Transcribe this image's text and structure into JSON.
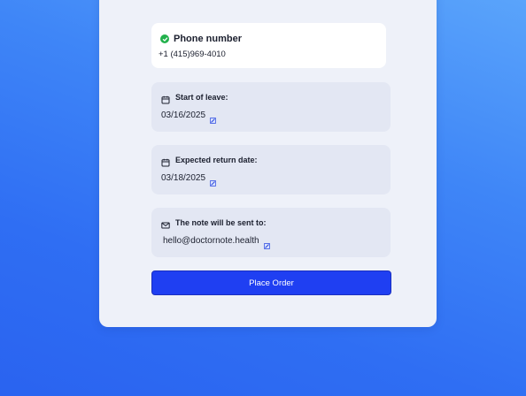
{
  "phone": {
    "title": "Phone number",
    "value": "+1 (415)969-4010",
    "icon": "check-circle-icon"
  },
  "start_of_leave": {
    "label": "Start of leave:",
    "value": "03/16/2025",
    "icon": "calendar-icon"
  },
  "return_date": {
    "label": "Expected return date:",
    "value": "03/18/2025",
    "icon": "calendar-icon"
  },
  "note_recipient": {
    "label": "The note will be sent to:",
    "value": "hello@doctornote.health",
    "icon": "mail-icon"
  },
  "place_order": {
    "label": "Place Order"
  },
  "colors": {
    "accent": "#1f3ff2",
    "success": "#22b14c",
    "card_bg": "#eef1f9",
    "field_bg": "#e3e7f3"
  }
}
